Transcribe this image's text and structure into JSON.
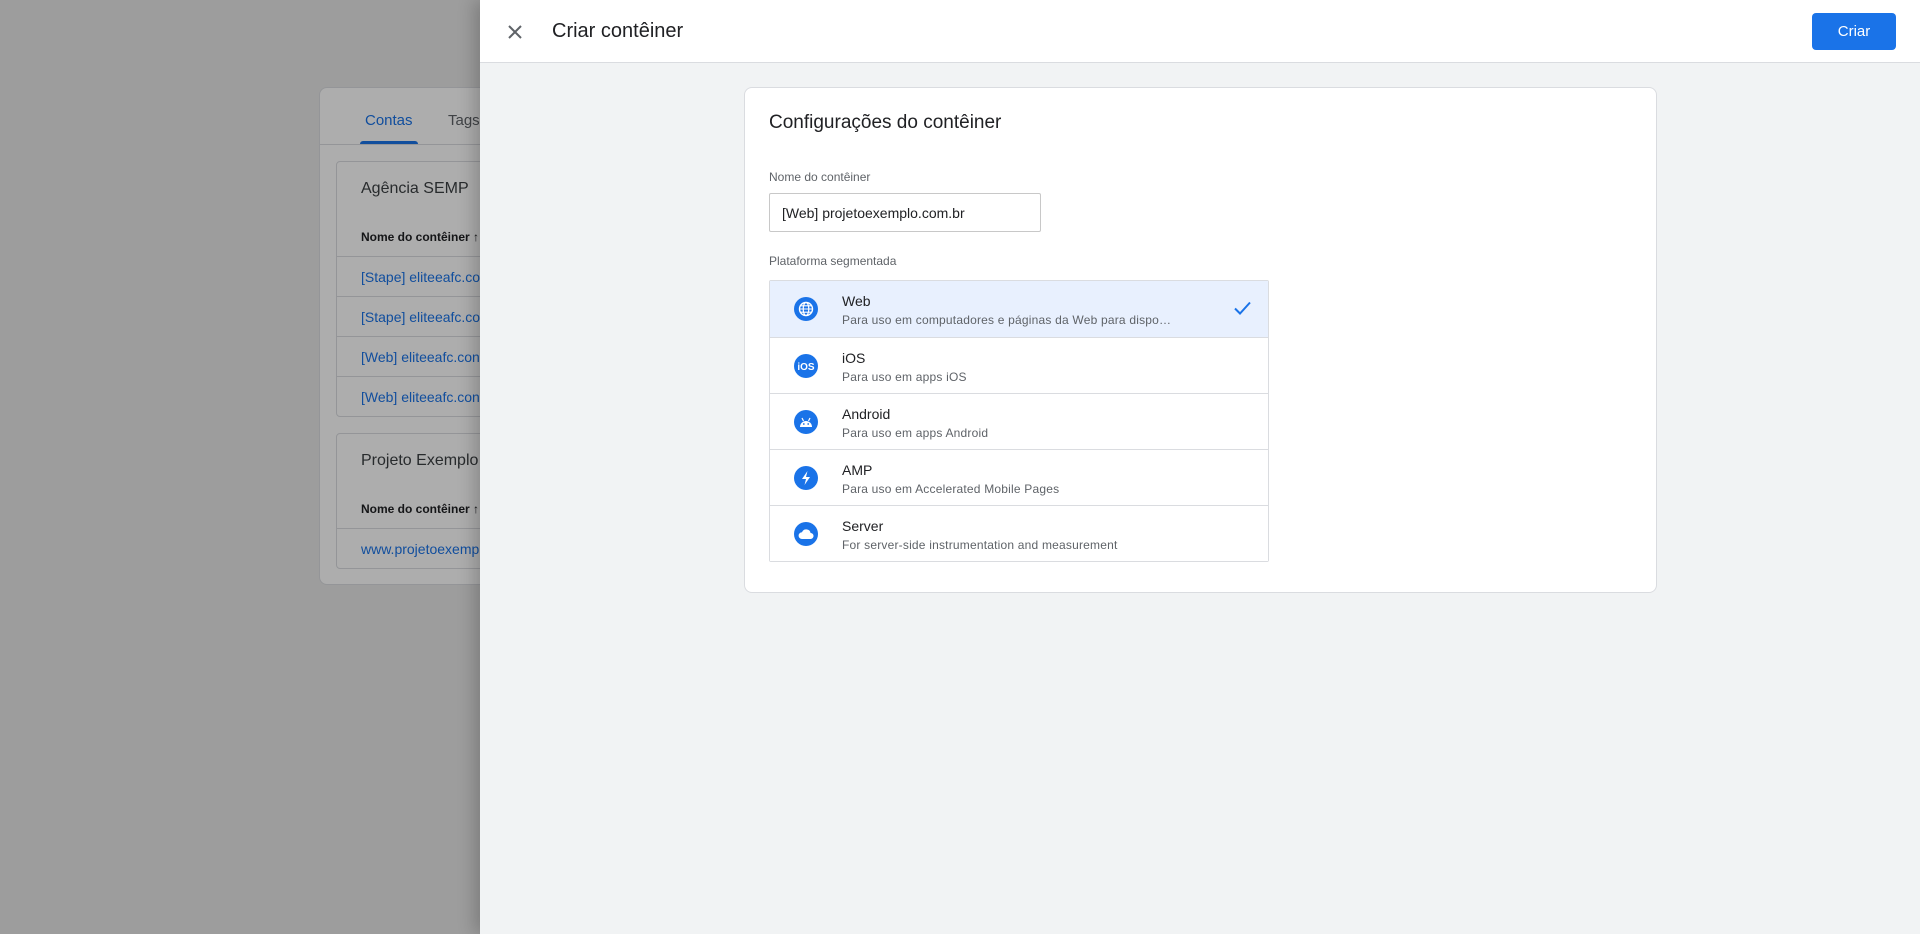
{
  "background": {
    "tabs": [
      "Contas",
      "Tags"
    ],
    "accounts": [
      {
        "name": "Agência SEMP",
        "column_header": "Nome do contêiner ↑",
        "rows": [
          "[Stape] eliteeafc.co",
          "[Stape] eliteeafc.co",
          "[Web] eliteeafc.con",
          "[Web] eliteeafc.con"
        ]
      },
      {
        "name": "Projeto Exemplo",
        "column_header": "Nome do contêiner ↑",
        "rows": [
          "www.projetoexemp"
        ]
      }
    ]
  },
  "panel": {
    "title": "Criar contêiner",
    "create_label": "Criar",
    "close_icon": "close-icon"
  },
  "config": {
    "title": "Configurações do contêiner",
    "name_label": "Nome do contêiner",
    "name_value": "[Web] projetoexemplo.com.br",
    "platform_label": "Plataforma segmentada",
    "selected_platform": "Web",
    "platforms": [
      {
        "name": "Web",
        "desc": "Para uso em computadores e páginas da Web para dispositivos móveis",
        "icon": "globe-icon"
      },
      {
        "name": "iOS",
        "desc": "Para uso em apps iOS",
        "icon": "ios-icon"
      },
      {
        "name": "Android",
        "desc": "Para uso em apps Android",
        "icon": "android-icon"
      },
      {
        "name": "AMP",
        "desc": "Para uso em Accelerated Mobile Pages",
        "icon": "amp-bolt-icon"
      },
      {
        "name": "Server",
        "desc": "For server-side instrumentation and measurement",
        "icon": "cloud-icon"
      }
    ]
  },
  "colors": {
    "accent": "#1a73e8",
    "selected_bg": "#e8f0fe",
    "panel_bg": "#f1f3f4"
  }
}
